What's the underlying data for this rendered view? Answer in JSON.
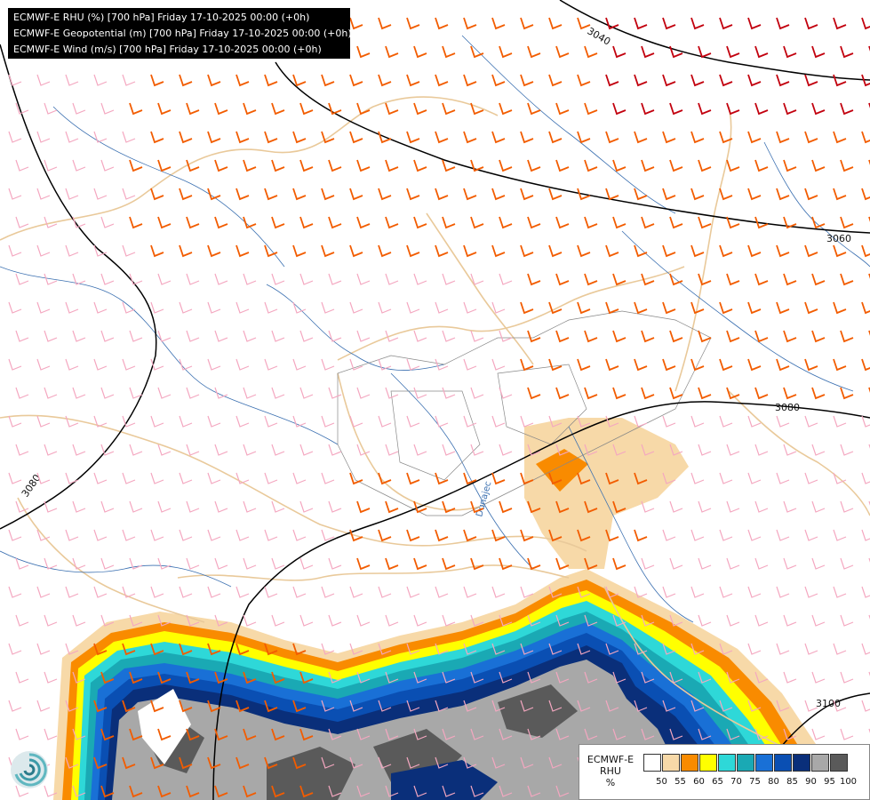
{
  "header": {
    "lines": [
      "ECMWF-E RHU (%) [700 hPa] Friday 17-10-2025 00:00 (+0h)",
      "ECMWF-E Geopotential (m) [700 hPa] Friday 17-10-2025 00:00 (+0h)",
      "ECMWF-E Wind (m/s) [700 hPa] Friday 17-10-2025 00:00 (+0h)"
    ]
  },
  "contours": {
    "labels": [
      "3040",
      "3060",
      "3080",
      "3080",
      "3100"
    ]
  },
  "map_labels": {
    "river": "Dunajec"
  },
  "legend": {
    "title_line1": "ECMWF-E",
    "title_line2": "RHU",
    "unit": "%",
    "colors": [
      "#ffffff",
      "#f7d9a8",
      "#f98b00",
      "#ffff00",
      "#2ed8d8",
      "#1aa9b4",
      "#1970d6",
      "#0a4fb3",
      "#0a2f7a",
      "#a8a8a8",
      "#5a5a5a"
    ],
    "ticks": [
      "50",
      "55",
      "60",
      "65",
      "70",
      "75",
      "80",
      "85",
      "90",
      "95",
      "100"
    ]
  },
  "colors": {
    "wind_light": "#f4a7c0",
    "wind_strong": "#f25c00",
    "wind_stronger": "#c2000e",
    "contour": "#000000",
    "border": "#e9c99a",
    "river": "#3a6fb0"
  },
  "icons": {
    "logo": "ecmwf-logo-icon"
  }
}
